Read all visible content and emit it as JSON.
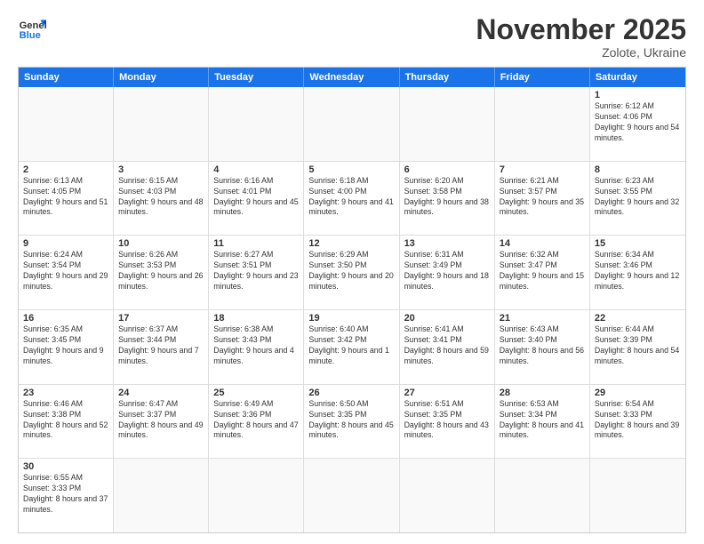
{
  "header": {
    "logo_general": "General",
    "logo_blue": "Blue",
    "month_title": "November 2025",
    "subtitle": "Zolote, Ukraine"
  },
  "days_of_week": [
    "Sunday",
    "Monday",
    "Tuesday",
    "Wednesday",
    "Thursday",
    "Friday",
    "Saturday"
  ],
  "rows": [
    [
      {
        "day": "",
        "info": ""
      },
      {
        "day": "",
        "info": ""
      },
      {
        "day": "",
        "info": ""
      },
      {
        "day": "",
        "info": ""
      },
      {
        "day": "",
        "info": ""
      },
      {
        "day": "",
        "info": ""
      },
      {
        "day": "1",
        "info": "Sunrise: 6:12 AM\nSunset: 4:06 PM\nDaylight: 9 hours and 54 minutes."
      }
    ],
    [
      {
        "day": "2",
        "info": "Sunrise: 6:13 AM\nSunset: 4:05 PM\nDaylight: 9 hours and 51 minutes."
      },
      {
        "day": "3",
        "info": "Sunrise: 6:15 AM\nSunset: 4:03 PM\nDaylight: 9 hours and 48 minutes."
      },
      {
        "day": "4",
        "info": "Sunrise: 6:16 AM\nSunset: 4:01 PM\nDaylight: 9 hours and 45 minutes."
      },
      {
        "day": "5",
        "info": "Sunrise: 6:18 AM\nSunset: 4:00 PM\nDaylight: 9 hours and 41 minutes."
      },
      {
        "day": "6",
        "info": "Sunrise: 6:20 AM\nSunset: 3:58 PM\nDaylight: 9 hours and 38 minutes."
      },
      {
        "day": "7",
        "info": "Sunrise: 6:21 AM\nSunset: 3:57 PM\nDaylight: 9 hours and 35 minutes."
      },
      {
        "day": "8",
        "info": "Sunrise: 6:23 AM\nSunset: 3:55 PM\nDaylight: 9 hours and 32 minutes."
      }
    ],
    [
      {
        "day": "9",
        "info": "Sunrise: 6:24 AM\nSunset: 3:54 PM\nDaylight: 9 hours and 29 minutes."
      },
      {
        "day": "10",
        "info": "Sunrise: 6:26 AM\nSunset: 3:53 PM\nDaylight: 9 hours and 26 minutes."
      },
      {
        "day": "11",
        "info": "Sunrise: 6:27 AM\nSunset: 3:51 PM\nDaylight: 9 hours and 23 minutes."
      },
      {
        "day": "12",
        "info": "Sunrise: 6:29 AM\nSunset: 3:50 PM\nDaylight: 9 hours and 20 minutes."
      },
      {
        "day": "13",
        "info": "Sunrise: 6:31 AM\nSunset: 3:49 PM\nDaylight: 9 hours and 18 minutes."
      },
      {
        "day": "14",
        "info": "Sunrise: 6:32 AM\nSunset: 3:47 PM\nDaylight: 9 hours and 15 minutes."
      },
      {
        "day": "15",
        "info": "Sunrise: 6:34 AM\nSunset: 3:46 PM\nDaylight: 9 hours and 12 minutes."
      }
    ],
    [
      {
        "day": "16",
        "info": "Sunrise: 6:35 AM\nSunset: 3:45 PM\nDaylight: 9 hours and 9 minutes."
      },
      {
        "day": "17",
        "info": "Sunrise: 6:37 AM\nSunset: 3:44 PM\nDaylight: 9 hours and 7 minutes."
      },
      {
        "day": "18",
        "info": "Sunrise: 6:38 AM\nSunset: 3:43 PM\nDaylight: 9 hours and 4 minutes."
      },
      {
        "day": "19",
        "info": "Sunrise: 6:40 AM\nSunset: 3:42 PM\nDaylight: 9 hours and 1 minute."
      },
      {
        "day": "20",
        "info": "Sunrise: 6:41 AM\nSunset: 3:41 PM\nDaylight: 8 hours and 59 minutes."
      },
      {
        "day": "21",
        "info": "Sunrise: 6:43 AM\nSunset: 3:40 PM\nDaylight: 8 hours and 56 minutes."
      },
      {
        "day": "22",
        "info": "Sunrise: 6:44 AM\nSunset: 3:39 PM\nDaylight: 8 hours and 54 minutes."
      }
    ],
    [
      {
        "day": "23",
        "info": "Sunrise: 6:46 AM\nSunset: 3:38 PM\nDaylight: 8 hours and 52 minutes."
      },
      {
        "day": "24",
        "info": "Sunrise: 6:47 AM\nSunset: 3:37 PM\nDaylight: 8 hours and 49 minutes."
      },
      {
        "day": "25",
        "info": "Sunrise: 6:49 AM\nSunset: 3:36 PM\nDaylight: 8 hours and 47 minutes."
      },
      {
        "day": "26",
        "info": "Sunrise: 6:50 AM\nSunset: 3:35 PM\nDaylight: 8 hours and 45 minutes."
      },
      {
        "day": "27",
        "info": "Sunrise: 6:51 AM\nSunset: 3:35 PM\nDaylight: 8 hours and 43 minutes."
      },
      {
        "day": "28",
        "info": "Sunrise: 6:53 AM\nSunset: 3:34 PM\nDaylight: 8 hours and 41 minutes."
      },
      {
        "day": "29",
        "info": "Sunrise: 6:54 AM\nSunset: 3:33 PM\nDaylight: 8 hours and 39 minutes."
      }
    ],
    [
      {
        "day": "30",
        "info": "Sunrise: 6:55 AM\nSunset: 3:33 PM\nDaylight: 8 hours and 37 minutes."
      },
      {
        "day": "",
        "info": ""
      },
      {
        "day": "",
        "info": ""
      },
      {
        "day": "",
        "info": ""
      },
      {
        "day": "",
        "info": ""
      },
      {
        "day": "",
        "info": ""
      },
      {
        "day": "",
        "info": ""
      }
    ]
  ]
}
